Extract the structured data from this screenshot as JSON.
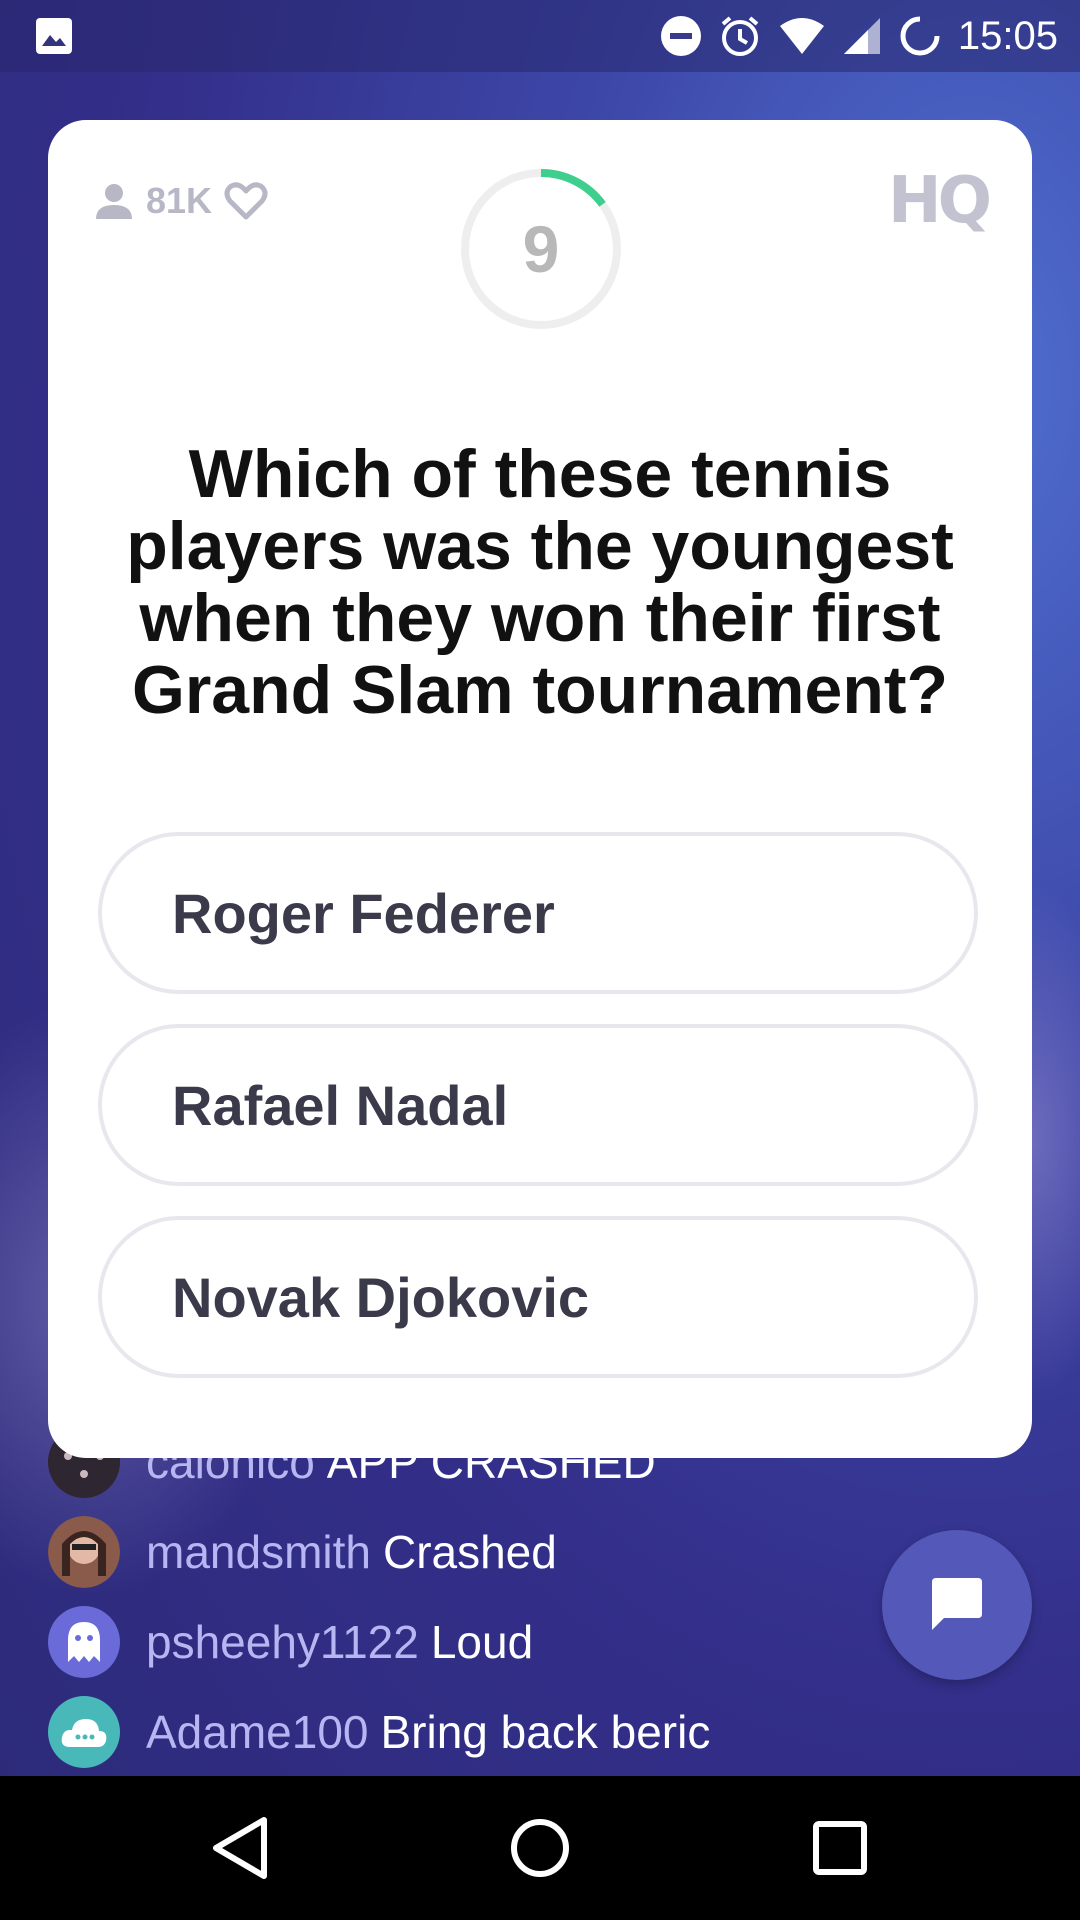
{
  "status_bar": {
    "time": "15:05",
    "icons": [
      "image-icon",
      "do-not-disturb-icon",
      "alarm-icon",
      "wifi-icon",
      "signal-icon",
      "sync-icon"
    ]
  },
  "card": {
    "viewer_count": "81K",
    "logo": "HQ",
    "timer": {
      "seconds": "9",
      "progress_fraction": 0.15,
      "accent_color": "#3ecf8e"
    },
    "question": "Which of these tennis players was the youngest when they won their first Grand Slam tournament?",
    "answers": [
      {
        "label": "Roger Federer"
      },
      {
        "label": "Rafael Nadal"
      },
      {
        "label": "Novak Djokovic"
      }
    ]
  },
  "chat": {
    "messages": [
      {
        "user": "calonico",
        "text": "APP CRASHED"
      },
      {
        "user": "mandsmith",
        "text": "Crashed"
      },
      {
        "user": "psheehy1122",
        "text": "Loud"
      },
      {
        "user": "Adame100",
        "text": "Bring back beric"
      }
    ]
  },
  "colors": {
    "background": "#332f8a",
    "chat_username": "#b8b6f2",
    "chat_button": "#5458b8"
  }
}
